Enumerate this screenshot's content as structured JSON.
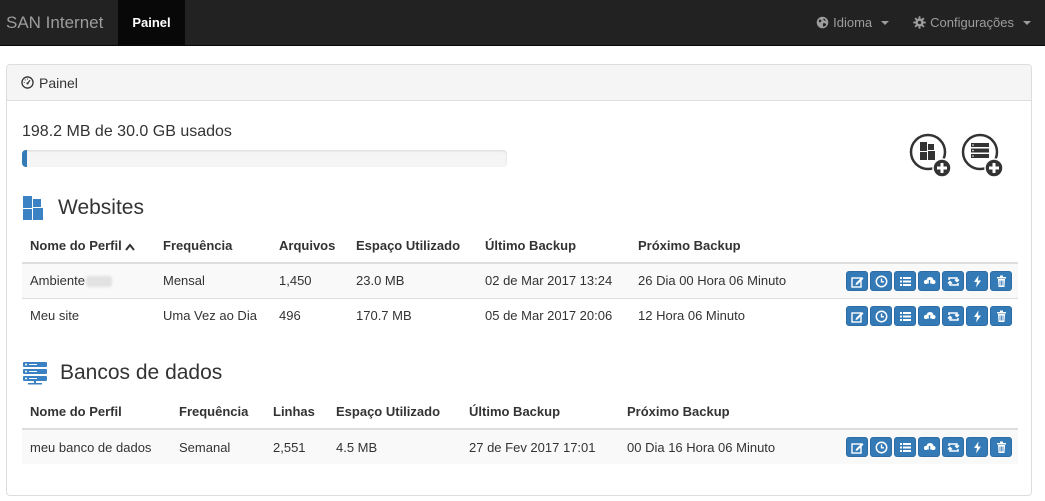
{
  "navbar": {
    "brand": "SAN Internet",
    "active_item": "Painel",
    "language_label": "Idioma",
    "settings_label": "Configurações"
  },
  "panel": {
    "title": "Painel",
    "usage_text": "198.2 MB de 30.0 GB usados",
    "usage_fraction": 0.0066
  },
  "websites": {
    "title": "Websites",
    "headers": [
      "Nome do Perfil",
      "Frequência",
      "Arquivos",
      "Espaço Utilizado",
      "Último Backup",
      "Próximo Backup"
    ],
    "rows": [
      {
        "name": "Ambiente",
        "frequency": "Mensal",
        "files": "1,450",
        "space": "23.0 MB",
        "last": "02 de Mar 2017 13:24",
        "next": "26 Dia 00 Hora 06 Minuto"
      },
      {
        "name": "Meu site",
        "frequency": "Uma Vez ao Dia",
        "files": "496",
        "space": "170.7 MB",
        "last": "05 de Mar 2017 20:06",
        "next": "12 Hora 06 Minuto"
      }
    ]
  },
  "databases": {
    "title": "Bancos de dados",
    "headers": [
      "Nome do Perfil",
      "Frequência",
      "Linhas",
      "Espaço Utilizado",
      "Último Backup",
      "Próximo Backup"
    ],
    "rows": [
      {
        "name": "meu banco de dados",
        "frequency": "Semanal",
        "files": "2,551",
        "space": "4.5 MB",
        "last": "27 de Fev 2017 17:01",
        "next": "00 Dia 16 Hora 06 Minuto"
      }
    ]
  },
  "row_actions": [
    "edit-icon",
    "clock-icon",
    "list-icon",
    "cloud-download-icon",
    "retweet-icon",
    "flash-icon",
    "trash-icon"
  ],
  "colors": {
    "navbar": "#222222",
    "primary": "#337ab7",
    "website_icon": "#3a82c4"
  }
}
